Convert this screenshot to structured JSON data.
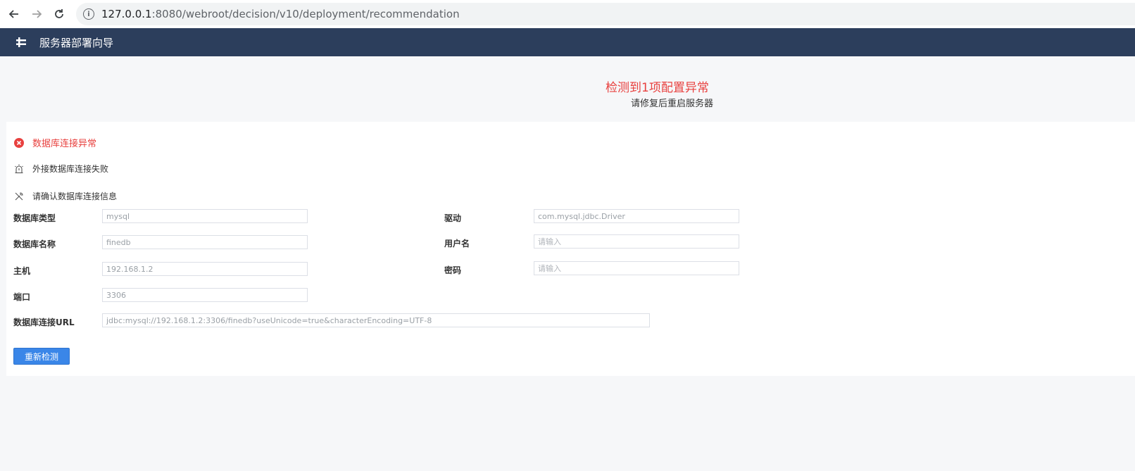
{
  "browser": {
    "url_host": "127.0.0.1",
    "url_path": ":8080/webroot/decision/v10/deployment/recommendation"
  },
  "header": {
    "title": "服务器部署向导"
  },
  "status": {
    "headline": "检测到1项配置异常",
    "subtitle": "请修复后重启服务器"
  },
  "issue": {
    "error_title": "数据库连接异常",
    "reason": "外接数据库连接失败",
    "fix_hint": "请确认数据库连接信息"
  },
  "form": {
    "db_type": {
      "label": "数据库类型",
      "value": "mysql"
    },
    "driver": {
      "label": "驱动",
      "value": "com.mysql.jdbc.Driver"
    },
    "db_name": {
      "label": "数据库名称",
      "value": "finedb"
    },
    "username": {
      "label": "用户名",
      "placeholder": "请输入"
    },
    "host": {
      "label": "主机",
      "value": "192.168.1.2"
    },
    "password": {
      "label": "密码",
      "placeholder": "请输入"
    },
    "port": {
      "label": "端口",
      "value": "3306"
    },
    "url": {
      "label": "数据库连接URL",
      "value": "jdbc:mysql://192.168.1.2:3306/finedb?useUnicode=true&characterEncoding=UTF-8"
    }
  },
  "actions": {
    "recheck_label": "重新检测"
  },
  "colors": {
    "header_bg": "#2c3e5c",
    "error_red": "#e8413f",
    "primary_blue": "#3a86e8"
  }
}
